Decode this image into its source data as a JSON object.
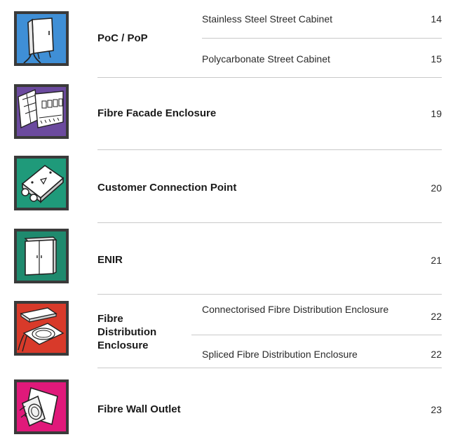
{
  "entries": [
    {
      "title": "PoC / PoP",
      "color": "#3f8fd6",
      "icon": "street-cabinet-icon",
      "items": [
        {
          "label": "Stainless Steel Street Cabinet",
          "page": "14"
        },
        {
          "label": "Polycarbonate Street Cabinet",
          "page": "15"
        }
      ]
    },
    {
      "title": "Fibre Facade Enclosure",
      "color": "#6b4a9e",
      "icon": "facade-enclosure-icon",
      "page": "19"
    },
    {
      "title": "Customer Connection Point",
      "color": "#1f9a7a",
      "icon": "connection-point-icon",
      "page": "20"
    },
    {
      "title": "ENIR",
      "color": "#1f8a6e",
      "icon": "enir-cabinet-icon",
      "page": "21"
    },
    {
      "title": "Fibre Distribution Enclosure",
      "color": "#d83a2a",
      "icon": "distribution-enclosure-icon",
      "items": [
        {
          "label": "Connectorised Fibre Distribution Enclosure",
          "page": "22"
        },
        {
          "label": "Spliced Fibre Distribution Enclosure",
          "page": "22"
        }
      ]
    },
    {
      "title": "Fibre Wall Outlet",
      "color": "#e0197a",
      "icon": "wall-outlet-icon",
      "page": "23"
    }
  ]
}
